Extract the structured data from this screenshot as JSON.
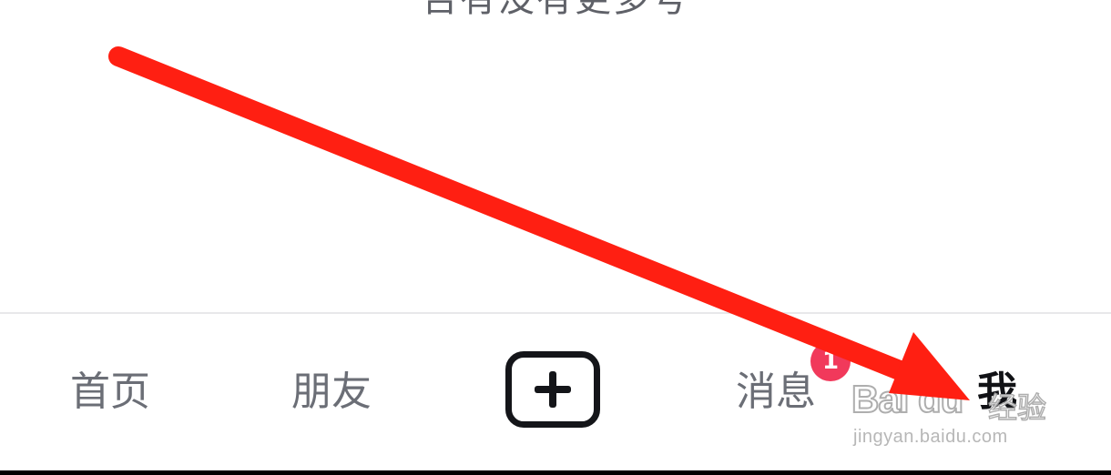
{
  "top_text": "否有没有更多号",
  "tabbar": {
    "home_label": "首页",
    "friends_label": "朋友",
    "add_icon": "plus-icon",
    "messages_label": "消息",
    "messages_badge": "1",
    "me_label": "我"
  },
  "watermark": {
    "logo": "Bai du",
    "cn": "经验",
    "url": "jingyan.baidu.com"
  },
  "colors": {
    "accent_arrow": "#ff1f12",
    "badge": "#f1395b",
    "active_tab": "#111216",
    "inactive_tab": "#6b6e76"
  }
}
